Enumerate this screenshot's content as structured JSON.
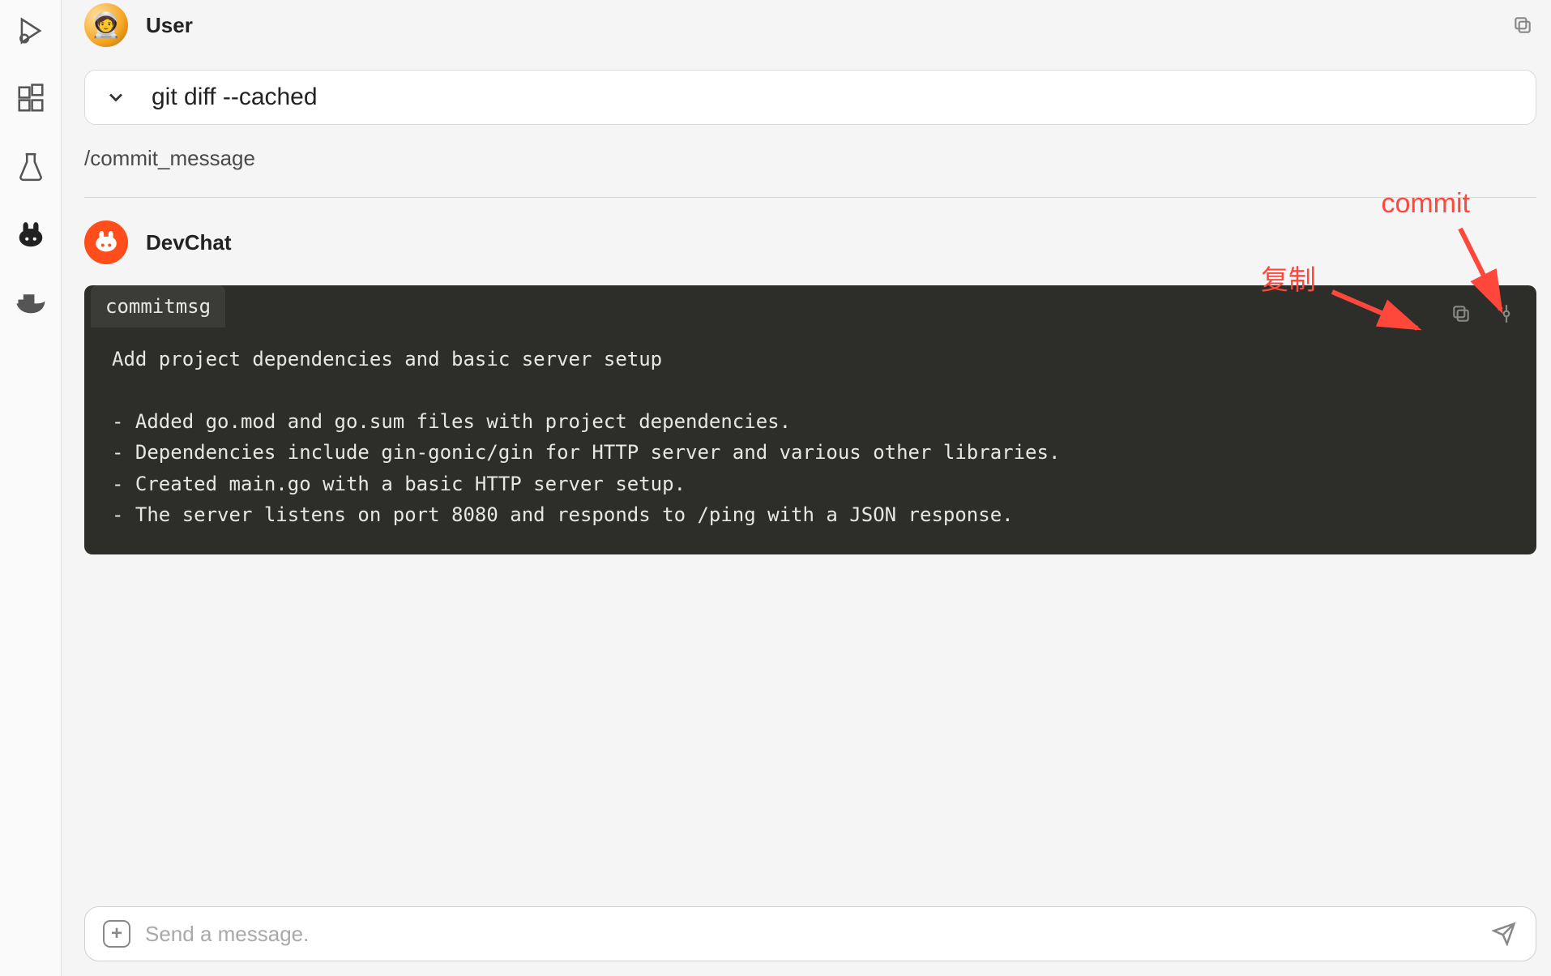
{
  "activity_bar": {
    "items": [
      {
        "name": "debug-icon"
      },
      {
        "name": "extensions-icon"
      },
      {
        "name": "beaker-icon"
      },
      {
        "name": "devchat-rabbit-icon"
      },
      {
        "name": "docker-icon"
      }
    ]
  },
  "messages": {
    "user": {
      "name": "User",
      "command_preview": "git diff --cached",
      "slash_command": "/commit_message"
    },
    "bot": {
      "name": "DevChat",
      "code_block": {
        "language_tab": "commitmsg",
        "content": "Add project dependencies and basic server setup\n\n- Added go.mod and go.sum files with project dependencies.\n- Dependencies include gin-gonic/gin for HTTP server and various other libraries.\n- Created main.go with a basic HTTP server setup.\n- The server listens on port 8080 and responds to /ping with a JSON response."
      }
    }
  },
  "annotations": {
    "copy_label": "复制",
    "commit_label": "commit"
  },
  "input": {
    "placeholder": "Send a message."
  }
}
